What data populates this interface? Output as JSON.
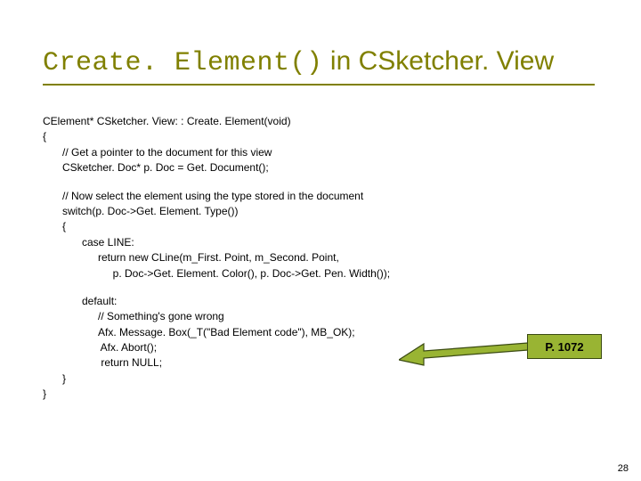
{
  "title": {
    "mono": "Create. Element()",
    "roman": " in CSketcher. View"
  },
  "code": {
    "sig": "CElement* CSketcher. View: : Create. Element(void)",
    "brace_open1": "{",
    "c1": "// Get a pointer to the document for this view",
    "c2": "CSketcher. Doc* p. Doc = Get. Document();",
    "c3": "// Now select the element using the type stored in the document",
    "c4": "switch(p. Doc->Get. Element. Type())",
    "brace_open2": "{",
    "case1": "case LINE:",
    "ret1a": "return new CLine(m_First. Point, m_Second. Point,",
    "ret1b": "     p. Doc->Get. Element. Color(), p. Doc->Get. Pen. Width());",
    "default": "default:",
    "dc1": "// Something's gone wrong",
    "dc2": "Afx. Message. Box(_T(\"Bad Element code\"), MB_OK);",
    "dc3": " Afx. Abort();",
    "dc4": " return NULL;",
    "brace_close2": "}",
    "brace_close1": "}"
  },
  "callout": {
    "label": "P. 1072"
  },
  "slidenum": "28"
}
